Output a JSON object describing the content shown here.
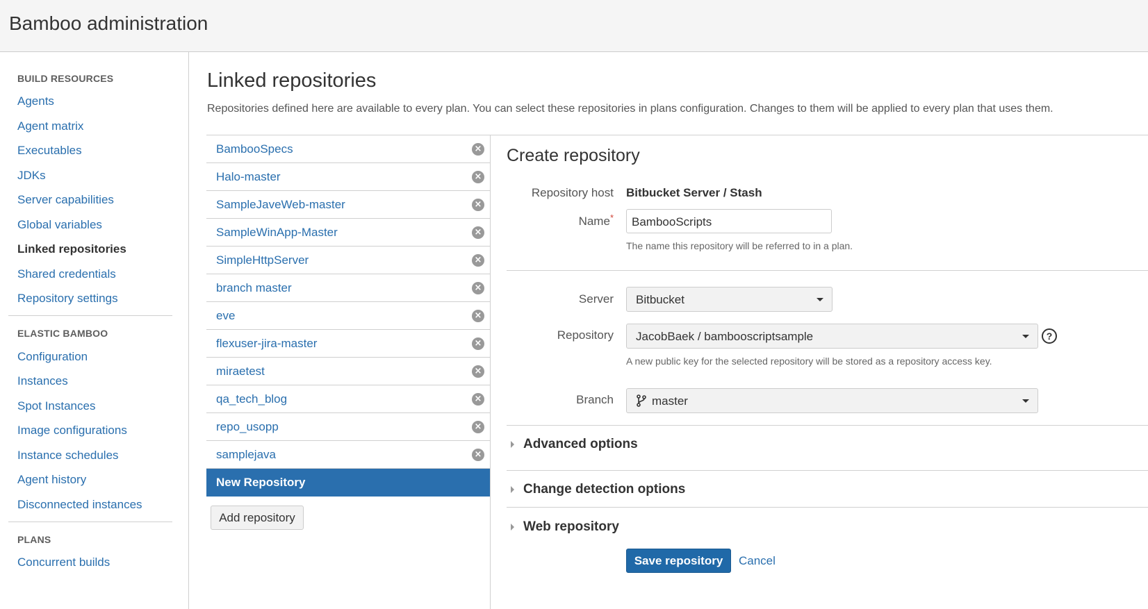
{
  "header": {
    "title": "Bamboo administration"
  },
  "sidebar": {
    "sections": [
      {
        "heading": "BUILD RESOURCES",
        "items": [
          "Agents",
          "Agent matrix",
          "Executables",
          "JDKs",
          "Server capabilities",
          "Global variables",
          "Linked repositories",
          "Shared credentials",
          "Repository settings"
        ]
      },
      {
        "heading": "ELASTIC BAMBOO",
        "items": [
          "Configuration",
          "Instances",
          "Spot Instances",
          "Image configurations",
          "Instance schedules",
          "Agent history",
          "Disconnected instances"
        ]
      },
      {
        "heading": "PLANS",
        "items": [
          "Concurrent builds"
        ]
      }
    ],
    "active_item": "Linked repositories"
  },
  "main": {
    "title": "Linked repositories",
    "description": "Repositories defined here are available to every plan. You can select these repositories in plans configuration. Changes to them will be applied to every plan that uses them."
  },
  "repo_list": {
    "items": [
      "BambooSpecs",
      "Halo-master",
      "SampleJaveWeb-master",
      "SampleWinApp-Master",
      "SimpleHttpServer",
      "branch master",
      "eve",
      "flexuser-jira-master",
      "miraetest",
      "qa_tech_blog",
      "repo_usopp",
      "samplejava"
    ],
    "remove_glyph": "×",
    "new_item": "New Repository",
    "add_button": "Add repository"
  },
  "form": {
    "title": "Create repository",
    "host_label": "Repository host",
    "host_value": "Bitbucket Server / Stash",
    "name_label": "Name",
    "required_mark": "*",
    "name_value": "BambooScripts",
    "name_hint": "The name this repository will be referred to in a plan.",
    "server_label": "Server",
    "server_value": "Bitbucket",
    "repository_label": "Repository",
    "repository_value": "JacobBaek / bambooscriptsample",
    "repository_help": "?",
    "repository_hint": "A new public key for the selected repository will be stored as a repository access key.",
    "branch_label": "Branch",
    "branch_value": "master",
    "sections": [
      "Advanced options",
      "Change detection options",
      "Web repository"
    ],
    "save_label": "Save repository",
    "cancel_label": "Cancel"
  },
  "colors": {
    "link": "#2a6fae",
    "primary_button": "#2069a8",
    "selected_item": "#2a6fae",
    "required": "#d04437",
    "header_bg": "#f5f5f5"
  }
}
